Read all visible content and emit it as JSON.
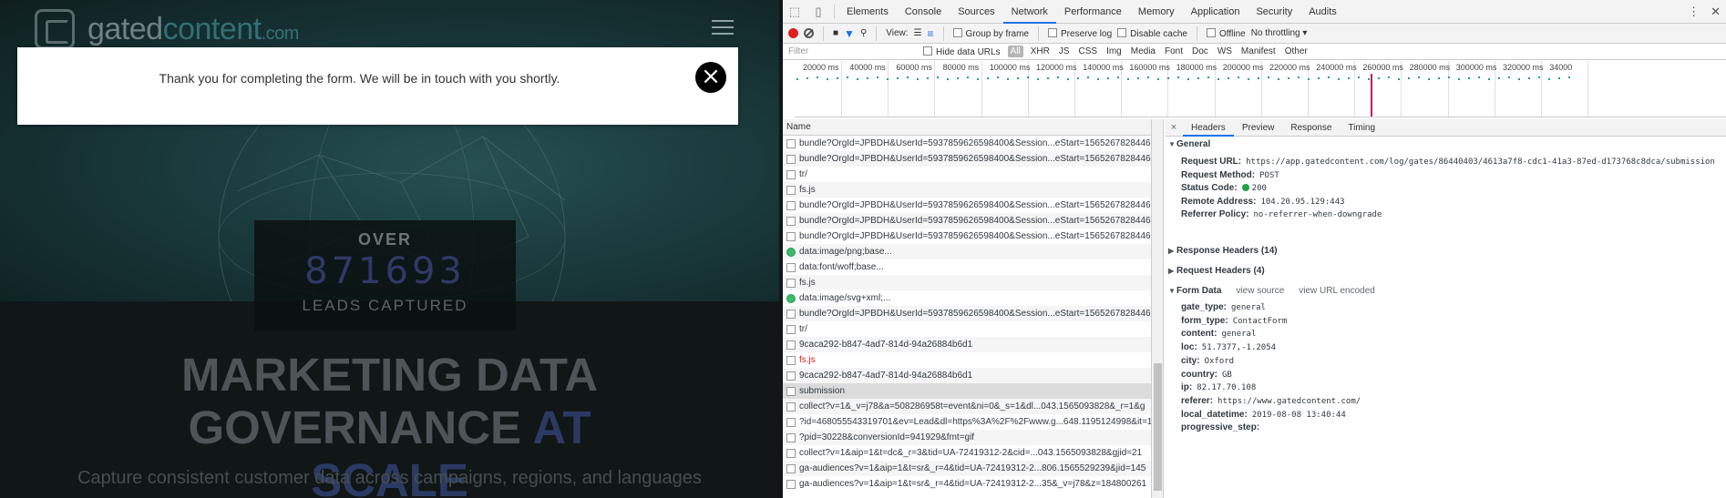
{
  "site": {
    "logo_brand": "gated",
    "logo_brand_accent": "content",
    "logo_tld": ".com",
    "modal_message": "Thank you for completing the form. We will be in touch with you shortly.",
    "modal_close_glyph": "×",
    "counter_over": "OVER",
    "counter_value": "871693",
    "counter_caption": "LEADS CAPTURED",
    "headline_main": "MARKETING DATA GOVERNANCE",
    "headline_accent_1": "AT",
    "headline_accent_2": "SCALE",
    "subline": "Capture consistent customer data across campaigns, regions, and languages"
  },
  "devtools": {
    "tabs": [
      "Elements",
      "Console",
      "Sources",
      "Network",
      "Performance",
      "Memory",
      "Application",
      "Security",
      "Audits"
    ],
    "active_tab": "Network",
    "toolbar": {
      "view_label": "View:",
      "group_by_frame": "Group by frame",
      "preserve_log": "Preserve log",
      "disable_cache": "Disable cache",
      "offline": "Offline",
      "throttling": "No throttling"
    },
    "filter": {
      "placeholder": "Filter",
      "hide_data_urls": "Hide data URLs",
      "types": [
        "All",
        "XHR",
        "JS",
        "CSS",
        "Img",
        "Media",
        "Font",
        "Doc",
        "WS",
        "Manifest",
        "Other"
      ],
      "selected_type": "All"
    },
    "timeline_ticks": [
      "20000 ms",
      "40000 ms",
      "60000 ms",
      "80000 ms",
      "100000 ms",
      "120000 ms",
      "140000 ms",
      "160000 ms",
      "180000 ms",
      "200000 ms",
      "220000 ms",
      "240000 ms",
      "260000 ms",
      "280000 ms",
      "300000 ms",
      "320000 ms",
      "34000"
    ],
    "list_header": "Name",
    "requests": [
      {
        "name": "bundle?OrgId=JPBDH&UserId=5937859626598400&Session...eStart=1565267828446&",
        "kind": "doc",
        "state": ""
      },
      {
        "name": "bundle?OrgId=JPBDH&UserId=5937859626598400&Session...eStart=1565267828446&",
        "kind": "doc",
        "state": ""
      },
      {
        "name": "tr/",
        "kind": "doc",
        "state": ""
      },
      {
        "name": "fs.js",
        "kind": "doc",
        "state": ""
      },
      {
        "name": "bundle?OrgId=JPBDH&UserId=5937859626598400&Session...eStart=1565267828446&",
        "kind": "doc",
        "state": ""
      },
      {
        "name": "bundle?OrgId=JPBDH&UserId=5937859626598400&Session...eStart=1565267828446&",
        "kind": "doc",
        "state": ""
      },
      {
        "name": "bundle?OrgId=JPBDH&UserId=5937859626598400&Session...eStart=1565267828446&",
        "kind": "doc",
        "state": ""
      },
      {
        "name": "data:image/png;base...",
        "kind": "img",
        "state": ""
      },
      {
        "name": "data:font/woff;base...",
        "kind": "doc",
        "state": ""
      },
      {
        "name": "fs.js",
        "kind": "doc",
        "state": ""
      },
      {
        "name": "data:image/svg+xml;...",
        "kind": "img",
        "state": ""
      },
      {
        "name": "bundle?OrgId=JPBDH&UserId=5937859626598400&Session...eStart=1565267828446&",
        "kind": "doc",
        "state": ""
      },
      {
        "name": "tr/",
        "kind": "doc",
        "state": ""
      },
      {
        "name": "9caca292-b847-4ad7-814d-94a26884b6d1",
        "kind": "doc",
        "state": ""
      },
      {
        "name": "fs.js",
        "kind": "doc",
        "state": "error"
      },
      {
        "name": "9caca292-b847-4ad7-814d-94a26884b6d1",
        "kind": "doc",
        "state": ""
      },
      {
        "name": "submission",
        "kind": "doc",
        "state": "selected"
      },
      {
        "name": "collect?v=1&_v=j78&a=508286958t=event&ni=0&_s=1&dl...043.1565093828&_r=1&g",
        "kind": "doc",
        "state": ""
      },
      {
        "name": "?id=468055543319701&ev=Lead&dl=https%3A%2F%2Fwww.g...648.1195124998&it=1",
        "kind": "doc",
        "state": ""
      },
      {
        "name": "?pid=30228&conversionId=941929&fmt=gif",
        "kind": "doc",
        "state": ""
      },
      {
        "name": "collect?v=1&aip=1&t=dc&_r=3&tid=UA-72419312-2&cid=...043.1565093828&gjid=21",
        "kind": "doc",
        "state": ""
      },
      {
        "name": "ga-audiences?v=1&aip=1&t=sr&_r=4&tid=UA-72419312-2...806.1565529239&jid=145",
        "kind": "doc",
        "state": ""
      },
      {
        "name": "ga-audiences?v=1&aip=1&t=sr&_r=4&tid=UA-72419312-2...35&_v=j78&z=184800261",
        "kind": "doc",
        "state": ""
      }
    ],
    "detail": {
      "tabs": [
        "Headers",
        "Preview",
        "Response",
        "Timing"
      ],
      "active_tab": "Headers",
      "close_glyph": "×",
      "general_title": "General",
      "general": [
        {
          "key": "Request URL:",
          "value": "https://app.gatedcontent.com/log/gates/86440403/4613a7f8-cdc1-41a3-87ed-d173768c8dca/submission"
        },
        {
          "key": "Request Method:",
          "value": "POST"
        },
        {
          "key": "Status Code:",
          "value": "200"
        },
        {
          "key": "Remote Address:",
          "value": "104.20.95.129:443"
        },
        {
          "key": "Referrer Policy:",
          "value": "no-referrer-when-downgrade"
        }
      ],
      "response_headers": "Response Headers (14)",
      "request_headers": "Request Headers (4)",
      "form_data_title": "Form Data",
      "view_source": "view source",
      "view_url_encoded": "view URL encoded",
      "form_data": [
        {
          "key": "gate_type:",
          "value": "general"
        },
        {
          "key": "form_type:",
          "value": "ContactForm"
        },
        {
          "key": "content:",
          "value": "general"
        },
        {
          "key": "loc:",
          "value": "51.7377,-1.2054"
        },
        {
          "key": "city:",
          "value": "Oxford"
        },
        {
          "key": "country:",
          "value": "GB"
        },
        {
          "key": "ip:",
          "value": "82.17.70.108"
        },
        {
          "key": "referer:",
          "value": "https://www.gatedcontent.com/"
        },
        {
          "key": "local_datetime:",
          "value": "2019-08-08 13:40:44"
        },
        {
          "key": "progressive_step:",
          "value": ""
        }
      ]
    }
  }
}
